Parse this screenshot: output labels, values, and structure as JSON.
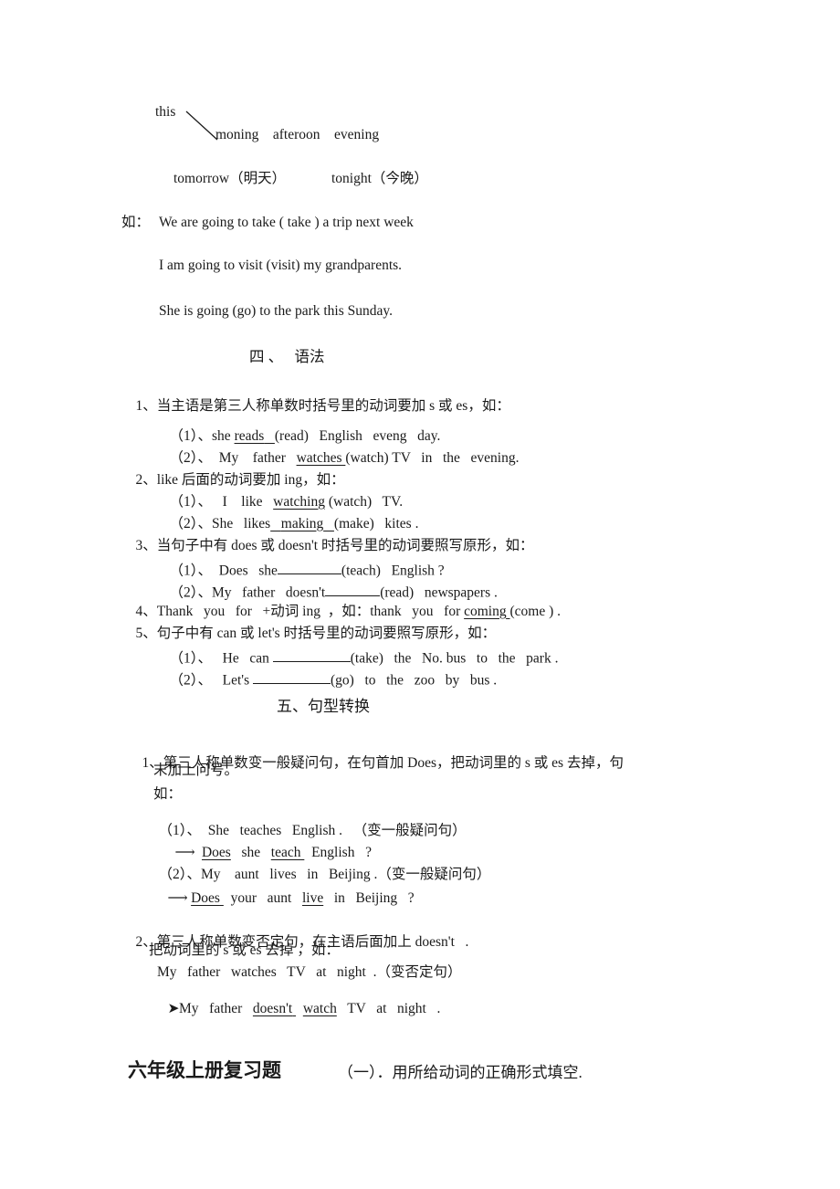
{
  "document": {
    "type": "worksheet",
    "language": "zh-CN + en",
    "title_bottom": "六年级上册复习题",
    "title_bottom_sub": "（一）．用所给动词的正确形式填空."
  },
  "time_words": {
    "this_label": "this",
    "this_items": "moning    afteroon    evening",
    "tomorrow": "tomorrow（明天）",
    "tonight": "tonight（今晚）"
  },
  "examples_intro": {
    "marker": "如：",
    "line1": "We are going to take ( take ) a trip next week",
    "line2": "I am going to visit (visit) my grandparents.",
    "line3": "She is going (go) to the park this Sunday."
  },
  "section_four": {
    "heading": "四 、   语法",
    "rules": [
      {
        "num": "1、",
        "text": "当主语是第三人称单数时括号里的动词要加 s 或 es，如：",
        "examples": [
          {
            "label": "（1）、",
            "pre": "she",
            "answer": "reads",
            "post": "(read)   English   eveng   day."
          },
          {
            "label": "（2）、",
            "pre": "My    father",
            "answer": "watches",
            "post": "(watch) TV   in   the   evening."
          }
        ]
      },
      {
        "num": "2、",
        "text": "like 后面的动词要加 ing，如：",
        "examples": [
          {
            "label": "（1）、",
            "pre": "I    like",
            "answer": "watching",
            "post": "(watch)   TV."
          },
          {
            "label": "（2）、",
            "pre": "She   likes",
            "answer": "making",
            "post": "(make)   kites ."
          }
        ]
      },
      {
        "num": "3、",
        "text": "当句子中有 does 或 doesn't 时括号里的动词要照写原形，如：",
        "examples": [
          {
            "label": "（1）、",
            "pre": "Does   she",
            "answer": "",
            "post": "(teach)   English ?"
          },
          {
            "label": "（2）、",
            "pre": "My   father   doesn't",
            "answer": "",
            "post": "(read)   newspapers ."
          }
        ]
      },
      {
        "num": "4、",
        "text_pre": "Thank   you   for   +动词 ing  ，如：thank   you   for ",
        "answer": "coming",
        "text_post": "(come ) ."
      },
      {
        "num": "5、",
        "text": "句子中有 can 或 let's 时括号里的动词要照写原形，如：",
        "examples": [
          {
            "label": "（1）、",
            "pre": "He   can",
            "answer": "",
            "post": "(take)   the   No. bus   to   the   park ."
          },
          {
            "label": "（2）、",
            "pre": "Let's",
            "answer": "",
            "post": "(go)   to   the   zoo   by   bus ."
          }
        ]
      }
    ]
  },
  "section_five": {
    "heading": "五、句型转换",
    "item1": {
      "num": "1、",
      "text_line1": "第三人称单数变一般疑问句，在句首加 Does，把动词里的 s 或 es 去掉，句",
      "text_line2": "末加上问号。",
      "ru": "如：",
      "ex1_label": "（1）、",
      "ex1_source": "She   teaches   English .   （变一般疑问句）",
      "ex1_arrow": "⟶",
      "ex1_result_a": "Does",
      "ex1_result_b": "she",
      "ex1_result_c": "teach",
      "ex1_result_d": "English   ?",
      "ex2_label": "（2）、",
      "ex2_source": "My    aunt   lives   in   Beijing .（变一般疑问句）",
      "ex2_arrow": "⟶",
      "ex2_result_a": "Does",
      "ex2_result_b": "your   aunt",
      "ex2_result_c": "live",
      "ex2_result_d": "in   Beijing   ?"
    },
    "item2": {
      "num": "2、",
      "text_line1": "第三人称单数变否定句，在主语后面加上 doesn't   .",
      "text_line2": "把动词里的 s 或 es 去掉 ，如：",
      "ex_source": "My   father   watches   TV   at   night  .（变否定句）",
      "ex_arrow": "➤",
      "ex_result_a": "My   father",
      "ex_result_b": "doesn't",
      "ex_result_c": "watch",
      "ex_result_d": "TV   at   night   ."
    }
  }
}
